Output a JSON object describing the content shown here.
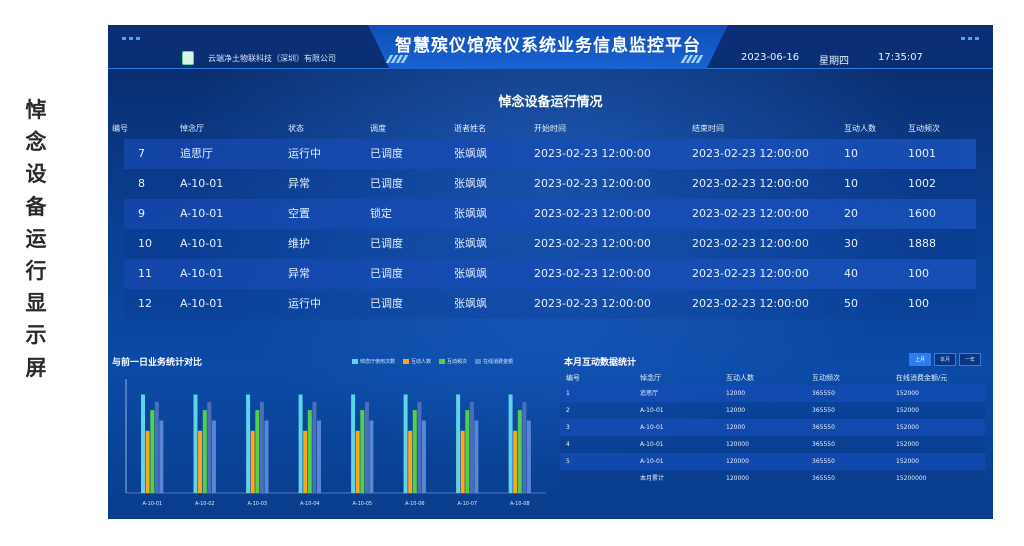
{
  "side_title": [
    "悼",
    "念",
    "设",
    "备",
    "运",
    "行",
    "显",
    "示",
    "屏"
  ],
  "header": {
    "company": "云端净土物联科技（深圳）有限公司",
    "title": "智慧殡仪馆殡仪系统业务信息监控平台",
    "date": "2023-06-16",
    "weekday": "星期四",
    "time": "17:35:07"
  },
  "section_title": "悼念设备运行情况",
  "main_table": {
    "columns": [
      "编号",
      "悼念厅",
      "状态",
      "调度",
      "逝者姓名",
      "开始时间",
      "结束时间",
      "互动人数",
      "互动频次"
    ],
    "rows": [
      [
        "7",
        "追思厅",
        "运行中",
        "已调度",
        "张飒飒",
        "2023-02-23  12:00:00",
        "2023-02-23  12:00:00",
        "10",
        "1001"
      ],
      [
        "8",
        "A-10-01",
        "异常",
        "已调度",
        "张飒飒",
        "2023-02-23  12:00:00",
        "2023-02-23  12:00:00",
        "10",
        "1002"
      ],
      [
        "9",
        "A-10-01",
        "空置",
        "锁定",
        "张飒飒",
        "2023-02-23  12:00:00",
        "2023-02-23  12:00:00",
        "20",
        "1600"
      ],
      [
        "10",
        "A-10-01",
        "维护",
        "已调度",
        "张飒飒",
        "2023-02-23  12:00:00",
        "2023-02-23  12:00:00",
        "30",
        "1888"
      ],
      [
        "11",
        "A-10-01",
        "异常",
        "已调度",
        "张飒飒",
        "2023-02-23  12:00:00",
        "2023-02-23  12:00:00",
        "40",
        "100"
      ],
      [
        "12",
        "A-10-01",
        "运行中",
        "已调度",
        "张飒飒",
        "2023-02-23  12:00:00",
        "2023-02-23  12:00:00",
        "50",
        "100"
      ]
    ]
  },
  "chart_panel": {
    "title": "与前一日业务统计对比"
  },
  "chart_data": {
    "type": "bar",
    "categories": [
      "A-10-01",
      "A-10-02",
      "A-10-03",
      "A-10-04",
      "A-10-05",
      "A-10-06",
      "A-10-07",
      "A-10-08"
    ],
    "series": [
      {
        "name": "悼念厅使用次数",
        "color": "#5fd3e8",
        "values": [
          95,
          95,
          95,
          95,
          95,
          95,
          95,
          95
        ]
      },
      {
        "name": "互动人数",
        "color": "#ffa51f",
        "values": [
          60,
          60,
          60,
          60,
          60,
          60,
          60,
          60
        ]
      },
      {
        "name": "互动频次",
        "color": "#52d04a",
        "values": [
          80,
          80,
          80,
          80,
          80,
          80,
          80,
          80
        ]
      },
      {
        "name": "在线消费金额",
        "color": "#5a86d6",
        "values": [
          70,
          70,
          70,
          70,
          70,
          70,
          70,
          70
        ]
      }
    ],
    "extra_bar": {
      "color": "#4a6fb8",
      "values": [
        88,
        88,
        88,
        88,
        88,
        88,
        88,
        88
      ]
    },
    "ylim": [
      0,
      110
    ],
    "legend_position": "top-right",
    "grid": false
  },
  "stat_panel": {
    "title": "本月互动数据统计",
    "pager": [
      "上月",
      "本月",
      "一年"
    ],
    "columns": [
      "编号",
      "悼念厅",
      "互动人数",
      "互动频次",
      "在线消费金额/元"
    ],
    "rows": [
      [
        "1",
        "追思厅",
        "12000",
        "365550",
        "152000"
      ],
      [
        "2",
        "A-10-01",
        "12000",
        "365550",
        "152000"
      ],
      [
        "3",
        "A-10-01",
        "12000",
        "365550",
        "152000"
      ],
      [
        "4",
        "A-10-01",
        "120000",
        "365550",
        "152000"
      ],
      [
        "5",
        "A-10-01",
        "120000",
        "365550",
        "152000"
      ],
      [
        "",
        "本月累计",
        "120000",
        "365550",
        "15200000"
      ]
    ]
  }
}
